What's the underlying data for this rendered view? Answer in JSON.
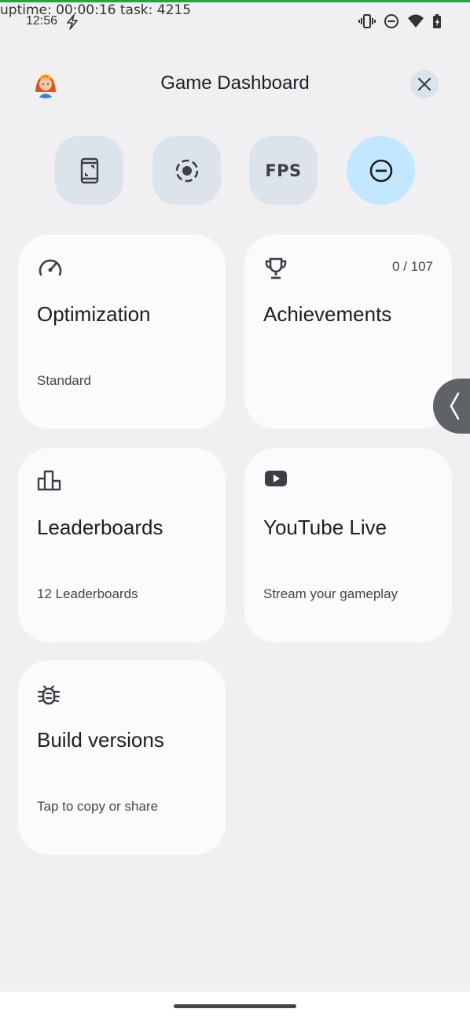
{
  "debug": {
    "text": "uptime: 00:00:16 task: 4215"
  },
  "status_bar": {
    "time": "12:56"
  },
  "header": {
    "title": "Game Dashboard"
  },
  "quick_buttons": [
    {
      "name": "screenshot",
      "icon": "phone-screenshot-icon"
    },
    {
      "name": "record",
      "icon": "record-icon"
    },
    {
      "name": "fps",
      "label": "FPS"
    },
    {
      "name": "do-not-disturb",
      "icon": "do-not-disturb-icon",
      "active": true
    }
  ],
  "tiles": [
    {
      "icon": "speedometer-icon",
      "title": "Optimization",
      "subtitle": "Standard"
    },
    {
      "icon": "trophy-icon",
      "title": "Achievements",
      "count": "0 / 107"
    },
    {
      "icon": "leaderboard-icon",
      "title": "Leaderboards",
      "subtitle": "12 Leaderboards"
    },
    {
      "icon": "youtube-icon",
      "title": "YouTube Live",
      "subtitle": "Stream your gameplay"
    },
    {
      "icon": "bug-icon",
      "title": "Build versions",
      "subtitle": "Tap to copy or share"
    }
  ],
  "colors": {
    "active_quick_button": "#c2e7ff",
    "quick_button": "#dde3ea",
    "tile": "#fbfbfd",
    "background": "#f0f0f2"
  }
}
